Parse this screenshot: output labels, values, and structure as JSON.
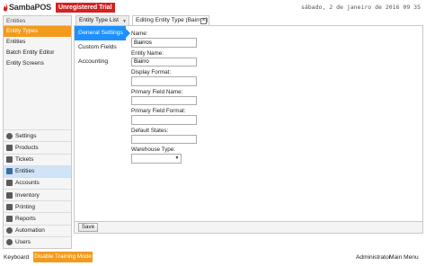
{
  "app": {
    "name": "SambaPOS",
    "trial_badge": "Unregistered Trial",
    "datetime": "sábado, 2 de janeiro de 2016 09 35"
  },
  "sidebar": {
    "header": "Entities",
    "items": [
      {
        "label": "Entity Types",
        "active": true
      },
      {
        "label": "Entities",
        "active": false
      },
      {
        "label": "Batch Entity Editor",
        "active": false
      },
      {
        "label": "Entity Screens",
        "active": false
      }
    ]
  },
  "nav": [
    {
      "label": "Settings",
      "icon": "gear-icon"
    },
    {
      "label": "Products",
      "icon": "cup-icon"
    },
    {
      "label": "Tickets",
      "icon": "ticket-icon"
    },
    {
      "label": "Entities",
      "icon": "entities-icon",
      "active": true
    },
    {
      "label": "Accounts",
      "icon": "accounts-icon"
    },
    {
      "label": "Inventory",
      "icon": "inventory-icon"
    },
    {
      "label": "Printing",
      "icon": "printer-icon"
    },
    {
      "label": "Reports",
      "icon": "chart-icon"
    },
    {
      "label": "Automation",
      "icon": "automation-icon"
    },
    {
      "label": "Users",
      "icon": "user-icon"
    }
  ],
  "tabs": {
    "list_label": "Entity Type List",
    "editing_label": "Editing Entity Type (Bairros)",
    "close_glyph": "×",
    "dropdown_glyph": "▼"
  },
  "editor_menu": [
    {
      "label": "General Settings",
      "active": true
    },
    {
      "label": "Custom Fields",
      "active": false
    },
    {
      "label": "Accounting",
      "active": false
    }
  ],
  "form": {
    "name_label": "Name:",
    "name_value": "Bairros",
    "entity_name_label": "Entity Name:",
    "entity_name_value": "Bairro",
    "display_format_label": "Display Format:",
    "display_format_value": "",
    "primary_field_name_label": "Primary Field Name:",
    "primary_field_name_value": "",
    "primary_field_format_label": "Primary Field Format:",
    "primary_field_format_value": "",
    "default_states_label": "Default States:",
    "default_states_value": "",
    "warehouse_type_label": "Warehouse Type:",
    "warehouse_type_value": "",
    "select_arrow": "▼"
  },
  "buttons": {
    "save": "Save"
  },
  "statusbar": {
    "keyboard": "Keyboard",
    "training": "Disable Training Mode",
    "user": "Administrator",
    "main_menu": "Main Menu"
  },
  "colors": {
    "accent_orange": "#f39a1c",
    "accent_blue": "#1e90ff",
    "trial_red": "#d32222"
  }
}
